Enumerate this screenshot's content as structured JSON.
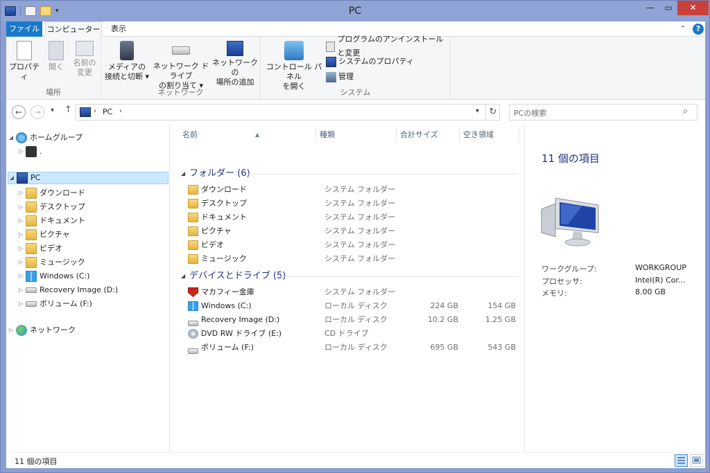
{
  "window": {
    "title": "PC"
  },
  "tabs": {
    "file": "ファイル",
    "computer": "コンピューター",
    "view": "表示"
  },
  "ribbon": {
    "location": {
      "label": "場所",
      "properties": "プロパティ",
      "open": "開く",
      "rename_1": "名前の",
      "rename_2": "変更"
    },
    "network": {
      "label": "ネットワーク",
      "media_1": "メディアの",
      "media_2": "接続と切断 ▾",
      "map_1": "ネットワーク ドライブ",
      "map_2": "の割り当て ▾",
      "addloc_1": "ネットワークの",
      "addloc_2": "場所の追加"
    },
    "system": {
      "label": "システム",
      "control_1": "コントロール パネル",
      "control_2": "を開く",
      "uninstall": "プログラムのアンインストールと変更",
      "sysprops": "システムのプロパティ",
      "manage": "管理"
    }
  },
  "address": {
    "crumb": "PC"
  },
  "search": {
    "placeholder": "PCの検索"
  },
  "tree": [
    {
      "label": "ホームグループ"
    },
    {
      "label": "."
    },
    {
      "label": "PC"
    },
    {
      "label": "ダウンロード"
    },
    {
      "label": "デスクトップ"
    },
    {
      "label": "ドキュメント"
    },
    {
      "label": "ピクチャ"
    },
    {
      "label": "ビデオ"
    },
    {
      "label": "ミュージック"
    },
    {
      "label": "Windows (C:)"
    },
    {
      "label": "Recovery Image (D:)"
    },
    {
      "label": "ボリューム (F:)"
    },
    {
      "label": "ネットワーク"
    }
  ],
  "columns": {
    "name": "名前",
    "type": "種類",
    "total": "合計サイズ",
    "free": "空き領域"
  },
  "groups": {
    "folders": "フォルダー (6)",
    "devices": "デバイスとドライブ (5)"
  },
  "folders": [
    {
      "name": "ダウンロード",
      "type": "システム フォルダー"
    },
    {
      "name": "デスクトップ",
      "type": "システム フォルダー"
    },
    {
      "name": "ドキュメント",
      "type": "システム フォルダー"
    },
    {
      "name": "ピクチャ",
      "type": "システム フォルダー"
    },
    {
      "name": "ビデオ",
      "type": "システム フォルダー"
    },
    {
      "name": "ミュージック",
      "type": "システム フォルダー"
    }
  ],
  "devices": [
    {
      "name": "マカフィー金庫",
      "type": "システム フォルダー",
      "total": "",
      "free": ""
    },
    {
      "name": "Windows (C:)",
      "type": "ローカル ディスク",
      "total": "224 GB",
      "free": "154 GB"
    },
    {
      "name": "Recovery Image (D:)",
      "type": "ローカル ディスク",
      "total": "10.2 GB",
      "free": "1.25 GB"
    },
    {
      "name": "DVD RW ドライブ (E:)",
      "type": "CD ドライブ",
      "total": "",
      "free": ""
    },
    {
      "name": "ボリューム (F:)",
      "type": "ローカル ディスク",
      "total": "695 GB",
      "free": "543 GB"
    }
  ],
  "details": {
    "title": "11 個の項目",
    "workgroup_label": "ワークグループ:",
    "workgroup_value": "WORKGROUP",
    "processor_label": "プロセッサ:",
    "processor_value": "Intel(R) Cor...",
    "memory_label": "メモリ:",
    "memory_value": "8.00 GB"
  },
  "status": {
    "count": "11 個の項目"
  }
}
